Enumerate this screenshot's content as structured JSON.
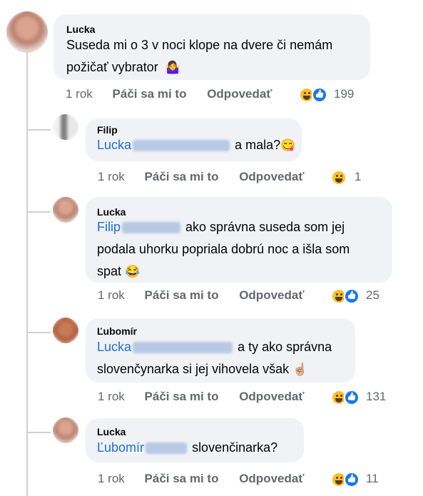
{
  "comments": [
    {
      "author": "Lucka",
      "mention": "",
      "text_line1": "Suseda mi o 3 v noci klope na dvere či nemám",
      "text_line2": "požičať vybrator",
      "emoji": "🤷‍♀️",
      "time": "1 rok",
      "like_label": "Páči sa mi to",
      "reply_label": "Odpovedať",
      "reaction_icons": [
        "haha-icon",
        "like-icon"
      ],
      "reaction_count": "199"
    },
    {
      "author": "Filip",
      "mention": "Lucka",
      "text_line1": "a mala?",
      "emoji": "😋",
      "time": "1 rok",
      "like_label": "Páči sa mi to",
      "reply_label": "Odpovedať",
      "reaction_icons": [
        "haha-icon"
      ],
      "reaction_count": "1"
    },
    {
      "author": "Lucka",
      "mention": "Filip",
      "text_line1": "ako správna suseda som jej",
      "text_line2": "podala uhorku popriala dobrú noc a išla som",
      "text_line3": "spat",
      "emoji": "😂",
      "time": "1 rok",
      "like_label": "Páči sa mi to",
      "reply_label": "Odpovedať",
      "reaction_icons": [
        "haha-icon",
        "like-icon"
      ],
      "reaction_count": "25"
    },
    {
      "author": "Ľubomír",
      "mention": "Lucka",
      "text_line1": "a ty ako správna",
      "text_line2": "slovenčynarka si jej vihovela však",
      "emoji": "☝🏼",
      "time": "1 rok",
      "like_label": "Páči sa mi to",
      "reply_label": "Odpovedať",
      "reaction_icons": [
        "haha-icon",
        "like-icon"
      ],
      "reaction_count": "131"
    },
    {
      "author": "Lucka",
      "mention": "Ľubomír",
      "text_line1": "slovenčinarka?",
      "time": "1 rok",
      "like_label": "Páči sa mi to",
      "reply_label": "Odpovedať",
      "reaction_icons": [
        "haha-icon",
        "like-icon"
      ],
      "reaction_count": "11"
    }
  ],
  "colors": {
    "bubble": "#f0f2f5",
    "mention": "#1d6fd6",
    "meta": "#65676b",
    "thread_line": "#ced0d4"
  }
}
